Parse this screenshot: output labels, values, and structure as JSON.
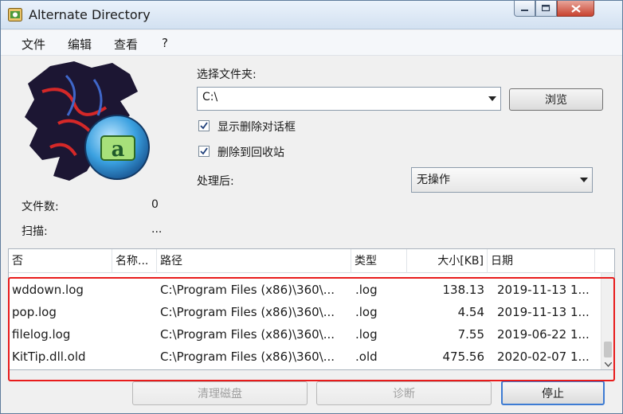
{
  "window": {
    "title": "Alternate Directory"
  },
  "menu": [
    "文件",
    "编辑",
    "查看",
    "?"
  ],
  "form": {
    "folder_label": "选择文件夹:",
    "folder_value": "C:\\",
    "browse_label": "浏览",
    "show_delete_dialog_label": "显示删除对话框",
    "show_delete_dialog_checked": true,
    "delete_to_recycle_label": "删除到回收站",
    "delete_to_recycle_checked": true,
    "after_label": "处理后:",
    "after_value": "无操作"
  },
  "stats": {
    "file_count_label": "文件数:",
    "file_count_value": "0",
    "scan_label": "扫描:",
    "scan_value": "..."
  },
  "table": {
    "columns": [
      "否",
      "名称...",
      "路径",
      "类型",
      "大小[KB]",
      "日期"
    ],
    "rows": [
      {
        "name": "wddown.log",
        "path": "C:\\Program Files (x86)\\360\\...",
        "type": ".log",
        "size": "138.13",
        "date": "2019-11-13 1..."
      },
      {
        "name": "pop.log",
        "path": "C:\\Program Files (x86)\\360\\...",
        "type": ".log",
        "size": "4.54",
        "date": "2019-11-13 1..."
      },
      {
        "name": "filelog.log",
        "path": "C:\\Program Files (x86)\\360\\...",
        "type": ".log",
        "size": "7.55",
        "date": "2019-06-22 1..."
      },
      {
        "name": "KitTip.dll.old",
        "path": "C:\\Program Files (x86)\\360\\...",
        "type": ".old",
        "size": "475.56",
        "date": "2020-02-07 1..."
      }
    ]
  },
  "buttons": {
    "clean": "清理磁盘",
    "diagnose": "诊断",
    "stop": "停止"
  },
  "colors": {
    "highlight": "#e81c1c",
    "accent": "#3d7bd3"
  }
}
